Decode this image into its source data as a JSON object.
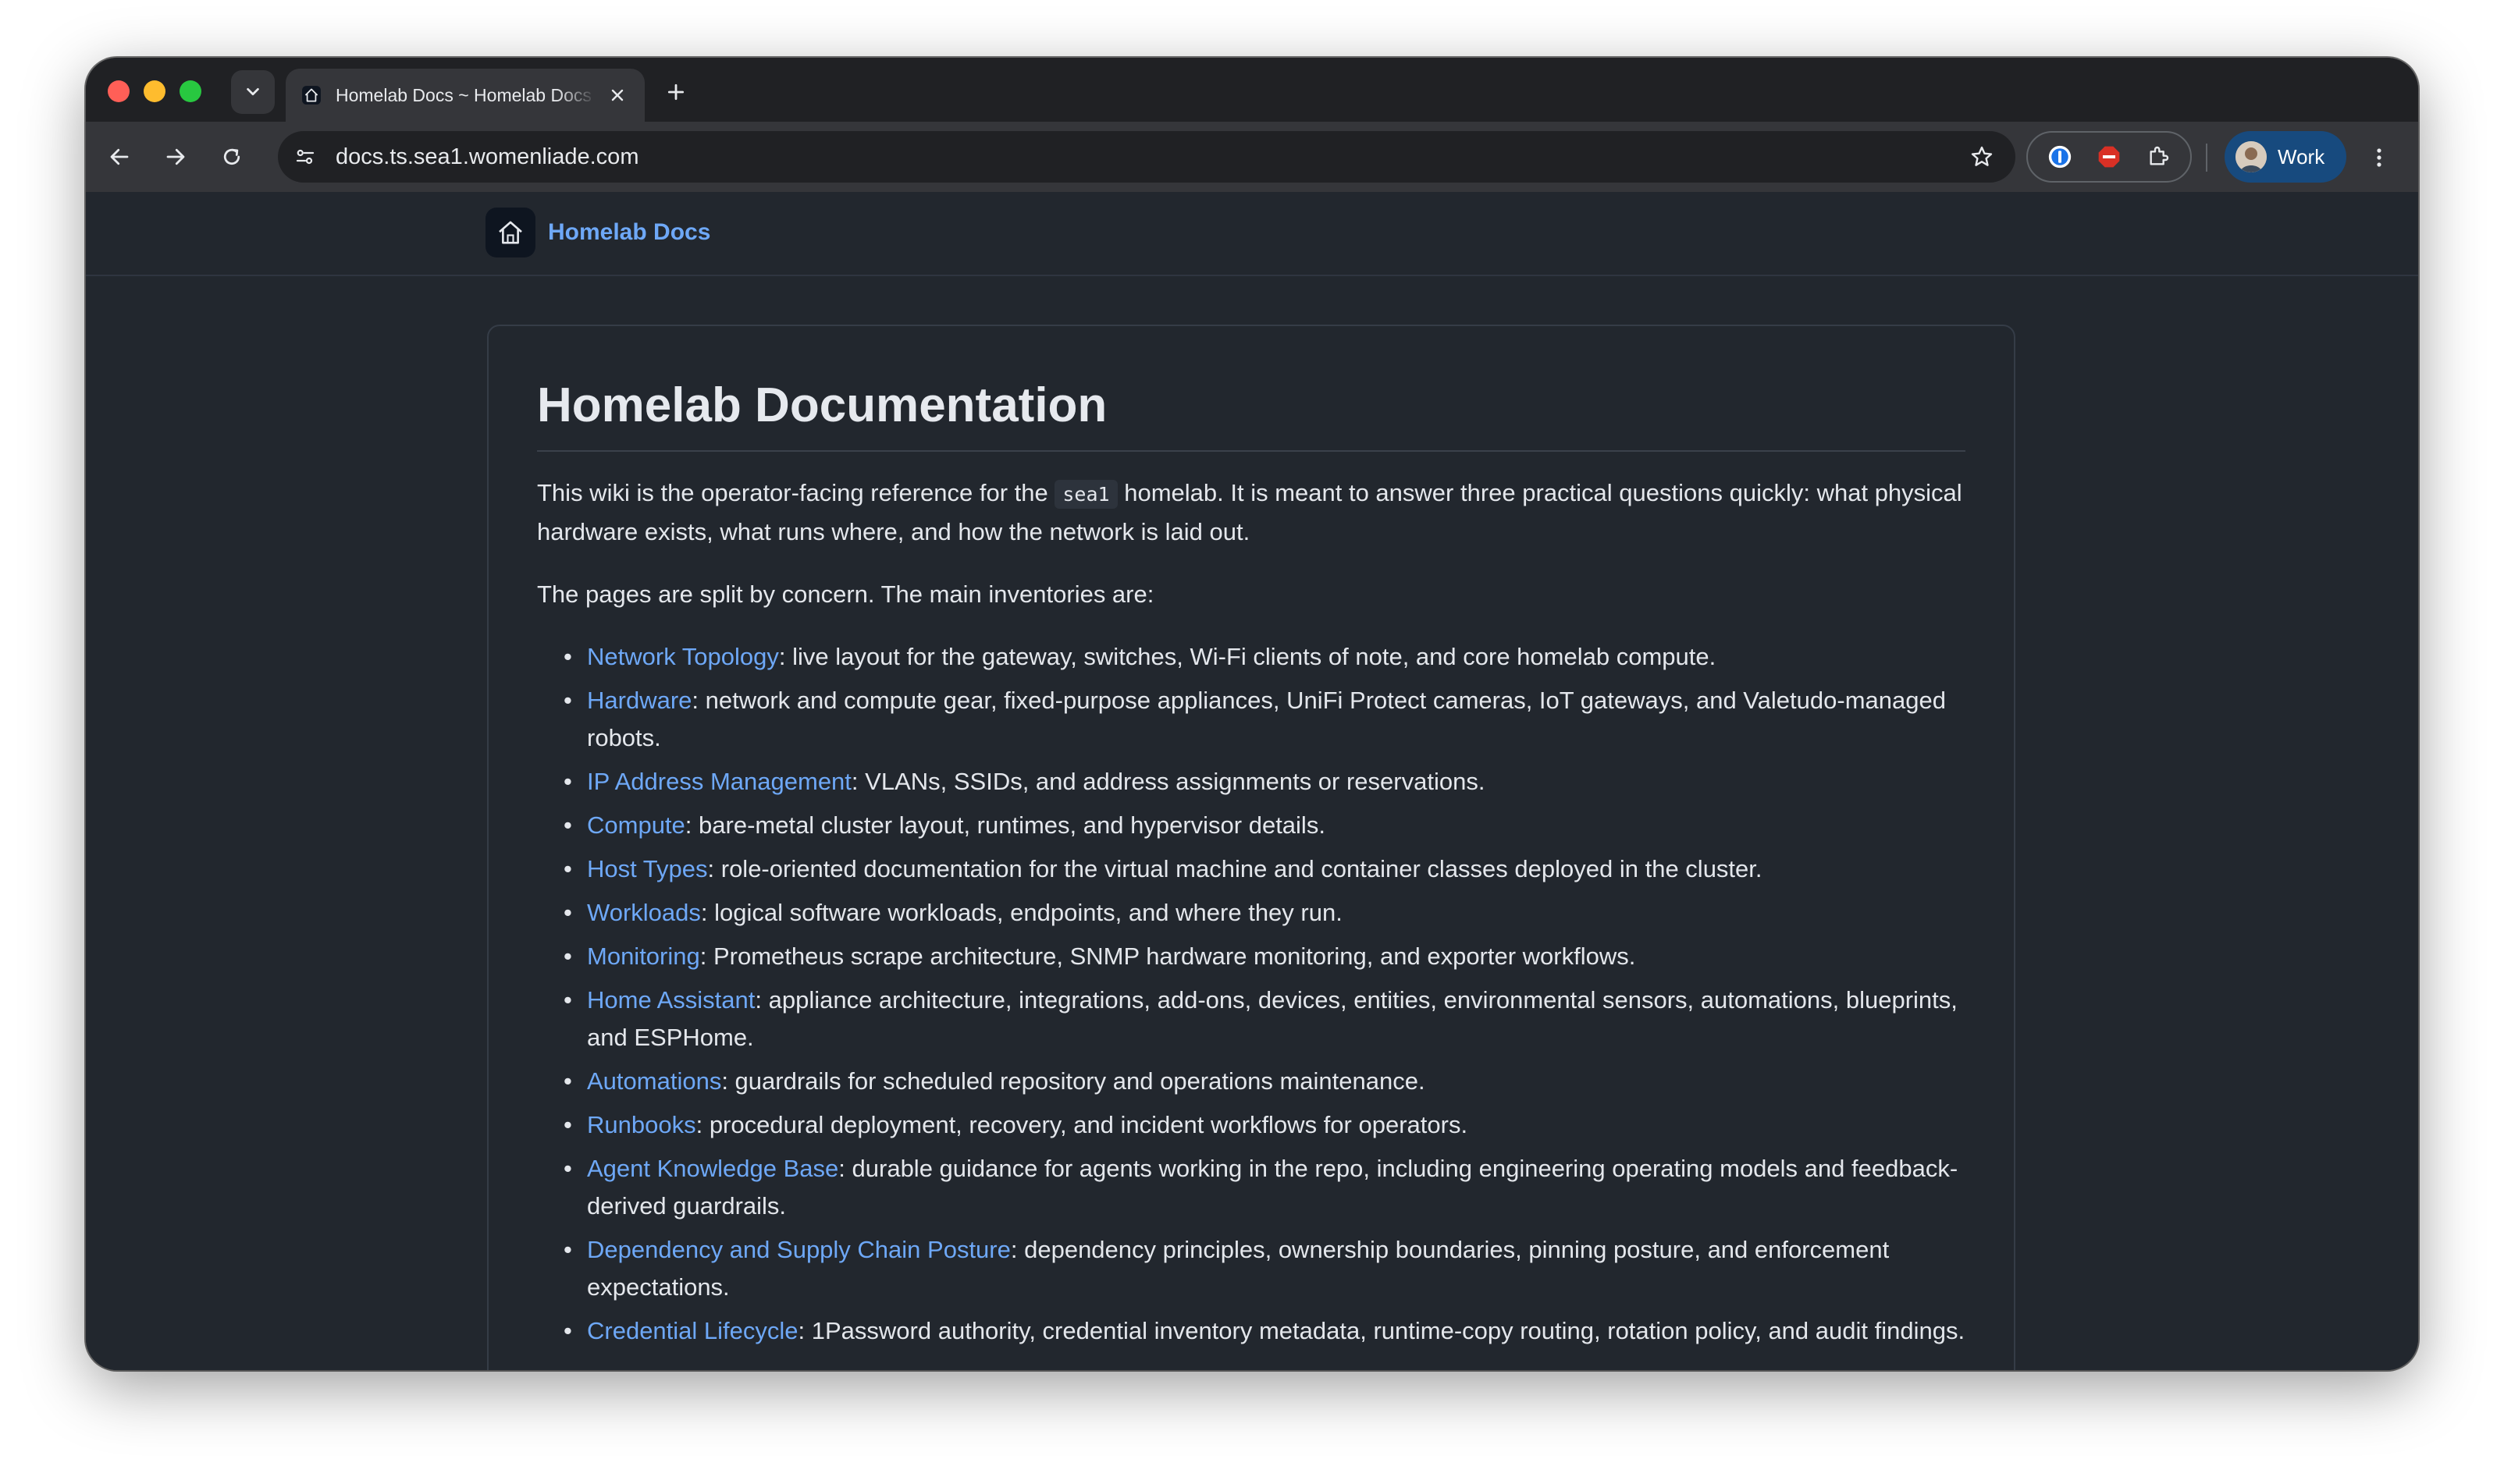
{
  "browser": {
    "tab": {
      "title": "Homelab Docs ~ Homelab Docs",
      "favicon": "house-icon"
    },
    "address_bar": {
      "url": "docs.ts.sea1.womenliade.com"
    },
    "profile": {
      "label": "Work"
    }
  },
  "site": {
    "brand": "Homelab Docs"
  },
  "doc": {
    "title": "Homelab Documentation",
    "intro": {
      "before": "This wiki is the operator-facing reference for the",
      "code": "sea1",
      "after": "homelab. It is meant to answer three practical questions quickly: what physical hardware exists, what runs where, and how the network is laid out."
    },
    "lead": "The pages are split by concern. The main inventories are:",
    "inventories": [
      {
        "link": "Network Topology",
        "desc": ": live layout for the gateway, switches, Wi-Fi clients of note, and core homelab compute."
      },
      {
        "link": "Hardware",
        "desc": ": network and compute gear, fixed-purpose appliances, UniFi Protect cameras, IoT gateways, and Valetudo-managed robots."
      },
      {
        "link": "IP Address Management",
        "desc": ": VLANs, SSIDs, and address assignments or reservations."
      },
      {
        "link": "Compute",
        "desc": ": bare-metal cluster layout, runtimes, and hypervisor details."
      },
      {
        "link": "Host Types",
        "desc": ": role-oriented documentation for the virtual machine and container classes deployed in the cluster."
      },
      {
        "link": "Workloads",
        "desc": ": logical software workloads, endpoints, and where they run."
      },
      {
        "link": "Monitoring",
        "desc": ": Prometheus scrape architecture, SNMP hardware monitoring, and exporter workflows."
      },
      {
        "link": "Home Assistant",
        "desc": ": appliance architecture, integrations, add-ons, devices, entities, environmental sensors, automations, blueprints, and ESPHome."
      },
      {
        "link": "Automations",
        "desc": ": guardrails for scheduled repository and operations maintenance."
      },
      {
        "link": "Runbooks",
        "desc": ": procedural deployment, recovery, and incident workflows for operators."
      },
      {
        "link": "Agent Knowledge Base",
        "desc": ": durable guidance for agents working in the repo, including engineering operating models and feedback-derived guardrails."
      },
      {
        "link": "Dependency and Supply Chain Posture",
        "desc": ": dependency principles, ownership boundaries, pinning posture, and enforcement expectations."
      },
      {
        "link": "Credential Lifecycle",
        "desc": ": 1Password authority, credential inventory metadata, runtime-copy routing, rotation policy, and audit findings."
      }
    ]
  },
  "colors": {
    "page_bg": "#22272e",
    "link": "#6ea8f7",
    "text": "#e4e7ec",
    "profile_chip": "#174a7e"
  }
}
